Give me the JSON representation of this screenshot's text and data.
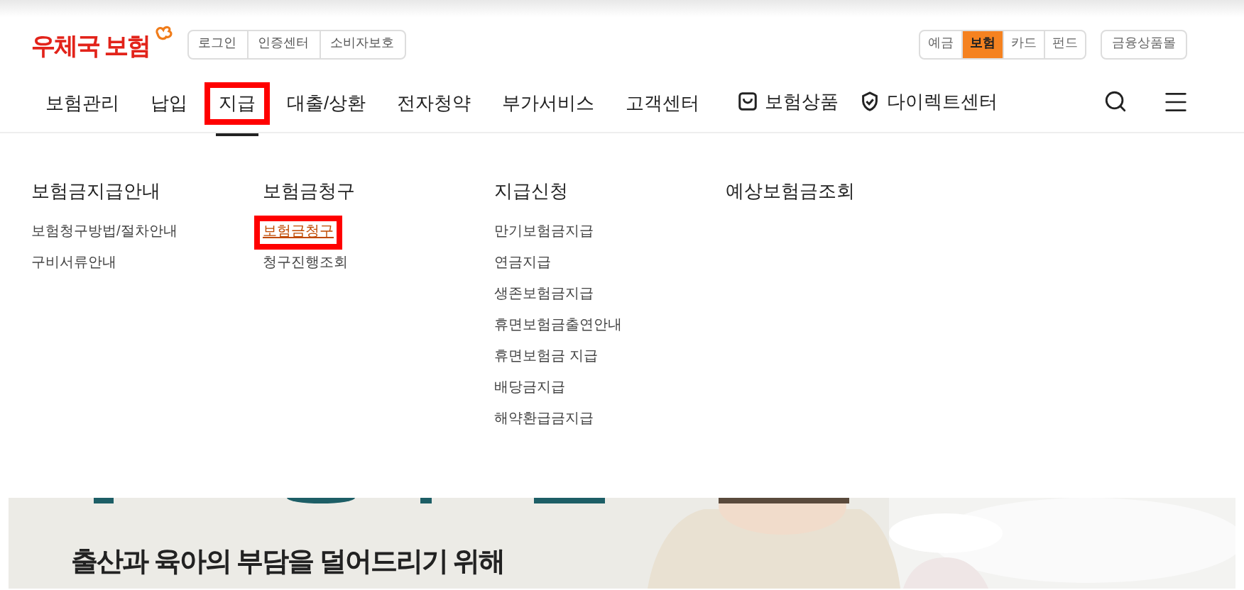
{
  "logo": {
    "text": "우체국 보험"
  },
  "util_links": [
    "로그인",
    "인증센터",
    "소비자보호"
  ],
  "product_tabs": [
    {
      "label": "예금",
      "selected": false
    },
    {
      "label": "보험",
      "selected": true
    },
    {
      "label": "카드",
      "selected": false
    },
    {
      "label": "펀드",
      "selected": false
    }
  ],
  "mall_link": "금융상품몰",
  "nav": [
    {
      "label": "보험관리",
      "selected": false,
      "highlighted": false
    },
    {
      "label": "납입",
      "selected": false,
      "highlighted": false
    },
    {
      "label": "지급",
      "selected": true,
      "highlighted": true
    },
    {
      "label": "대출/상환",
      "selected": false,
      "highlighted": false
    },
    {
      "label": "전자청약",
      "selected": false,
      "highlighted": false
    },
    {
      "label": "부가서비스",
      "selected": false,
      "highlighted": false
    },
    {
      "label": "고객센터",
      "selected": false,
      "highlighted": false
    }
  ],
  "nav_extra": [
    {
      "label": "보험상품",
      "kind": "bag"
    },
    {
      "label": "다이렉트센터",
      "kind": "shield"
    }
  ],
  "menu_columns": [
    {
      "heading": "보험금지급안내",
      "items": [
        {
          "label": "보험청구방법/절차안내",
          "highlighted": false
        },
        {
          "label": "구비서류안내",
          "highlighted": false
        }
      ]
    },
    {
      "heading": "보험금청구",
      "items": [
        {
          "label": "보험금청구",
          "highlighted": true
        },
        {
          "label": "청구진행조회",
          "highlighted": false
        }
      ]
    },
    {
      "heading": "지급신청",
      "items": [
        {
          "label": "만기보험금지급",
          "highlighted": false
        },
        {
          "label": "연금지급",
          "highlighted": false
        },
        {
          "label": "생존보험금지급",
          "highlighted": false
        },
        {
          "label": "휴면보험금출연안내",
          "highlighted": false
        },
        {
          "label": "휴면보험금 지급",
          "highlighted": false
        },
        {
          "label": "배당금지급",
          "highlighted": false
        },
        {
          "label": "해약환급금지급",
          "highlighted": false
        }
      ]
    },
    {
      "heading": "예상보험금조회"
    }
  ],
  "banner": {
    "caption": "출산과 육아의 부담을 덜어드리기 위해"
  }
}
